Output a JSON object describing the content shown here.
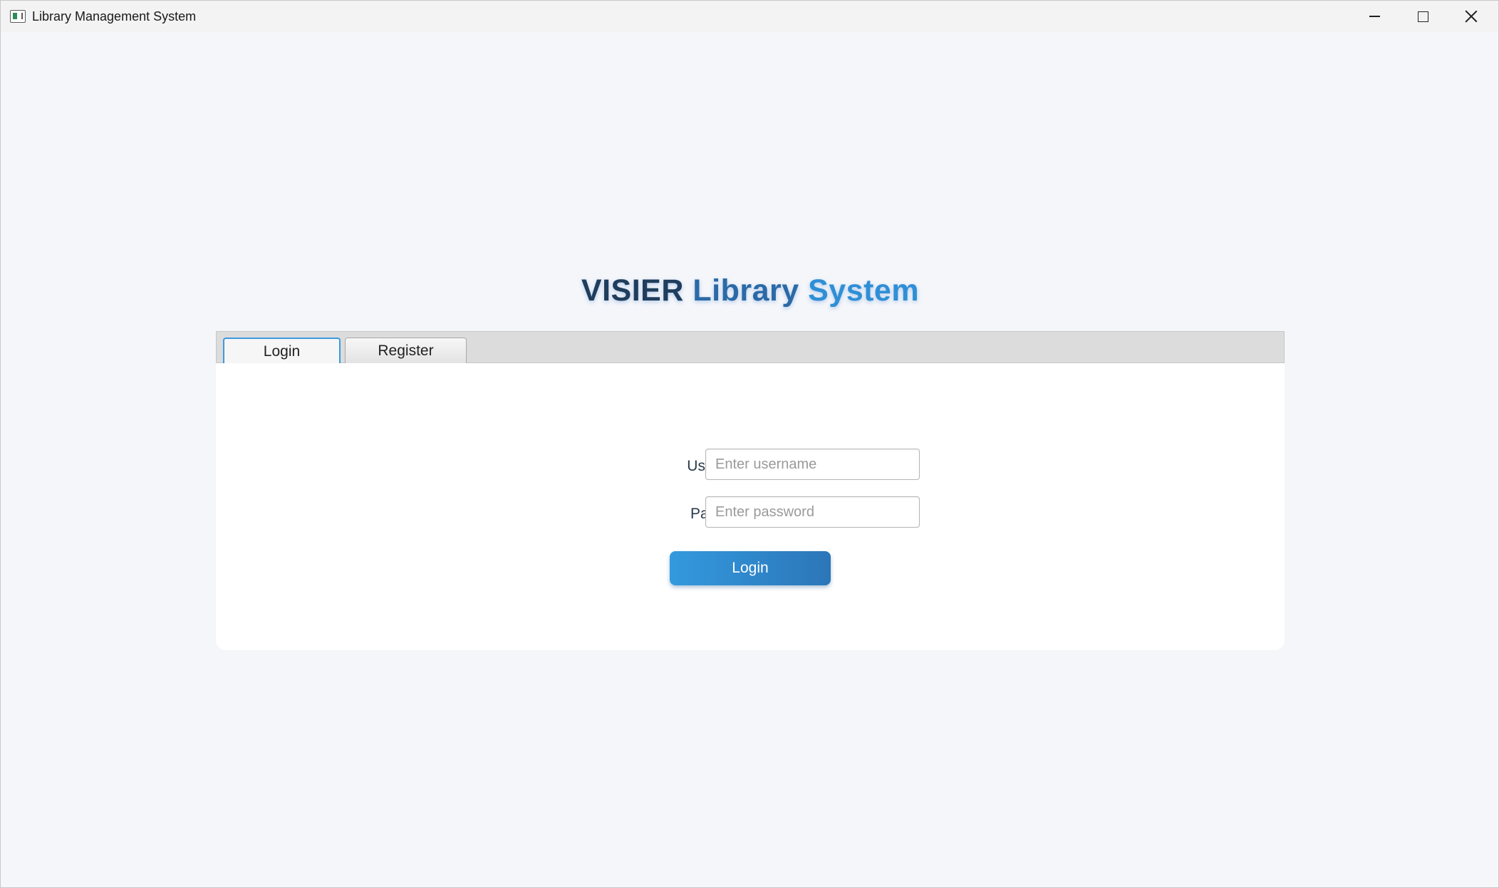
{
  "window": {
    "title": "Library Management System",
    "controls": {
      "minimize": "minimize-icon",
      "maximize": "maximize-icon",
      "close": "close-icon"
    }
  },
  "heading": {
    "word1": "VISIER",
    "word2": "Library",
    "word3": "System"
  },
  "tabs": [
    {
      "label": "Login",
      "selected": true
    },
    {
      "label": "Register",
      "selected": false
    }
  ],
  "login_form": {
    "username_label": "Username:",
    "username_value": "",
    "username_placeholder": "Enter username",
    "password_label": "Password:",
    "password_value": "",
    "password_placeholder": "Enter password",
    "submit_label": "Login"
  },
  "colors": {
    "accent": "#3499de",
    "heading_dark": "#1f3d5c",
    "heading_light": "#2f8fd6",
    "background": "#f4f6fa"
  }
}
